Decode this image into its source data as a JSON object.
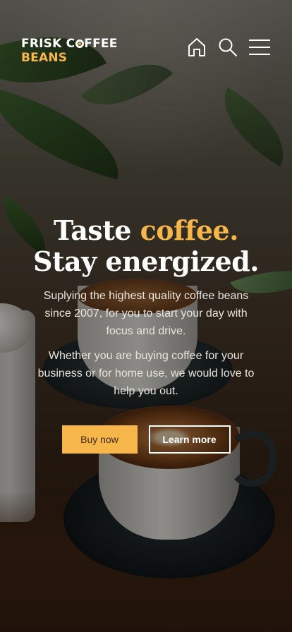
{
  "header": {
    "logo_line1_before": "FRISK C",
    "logo_line1_after": "FFEE",
    "logo_line2": "BEANS",
    "icons": [
      "home-icon",
      "search-icon",
      "menu-icon"
    ]
  },
  "hero": {
    "headline_part1": "Taste ",
    "headline_accent": "coffee.",
    "headline_line2": "Stay energized.",
    "paragraph1": "Suplying the highest quality coffee beans since 2007, for you to start your day with focus and drive.",
    "paragraph2": "Whether you are buying coffee for your business or for home use, we would love to help you out.",
    "buy_label": "Buy now",
    "learn_label": "Learn more"
  },
  "colors": {
    "accent": "#f6b64a",
    "text_light": "#ffffff"
  }
}
